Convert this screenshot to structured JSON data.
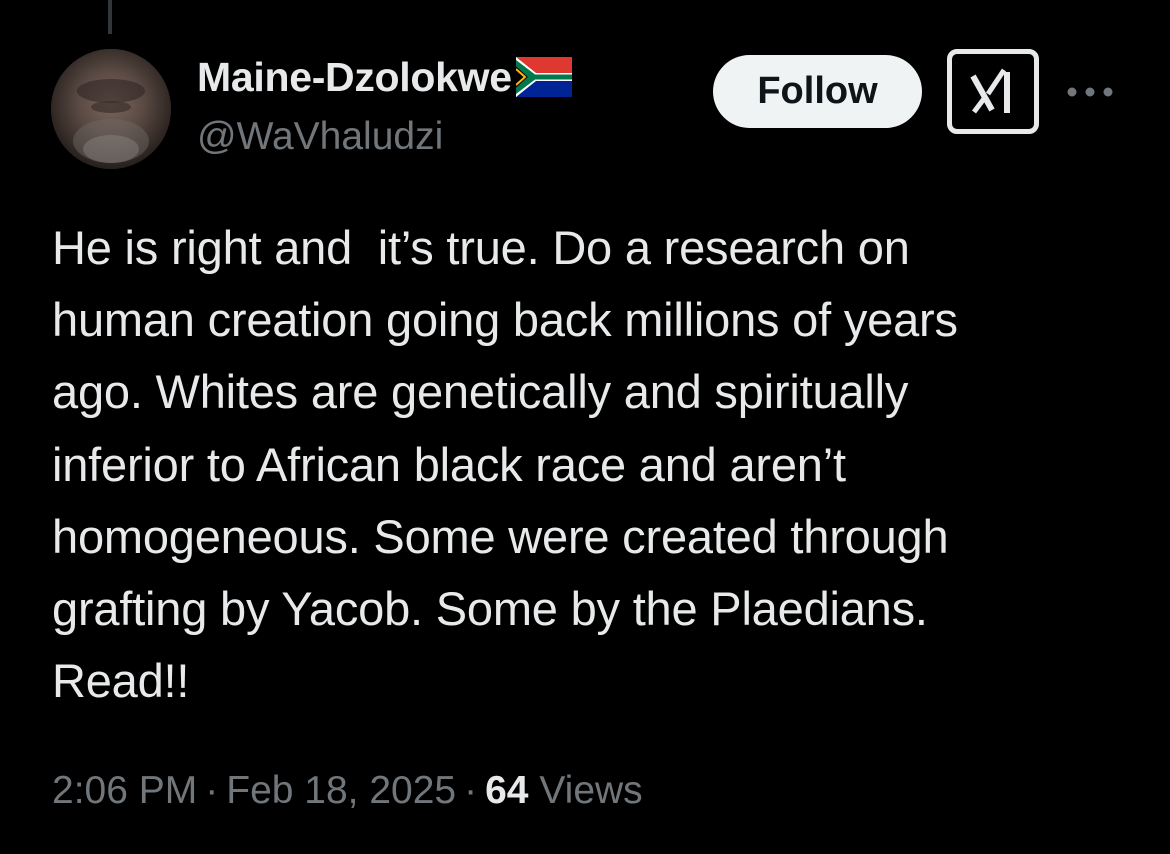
{
  "tweet": {
    "author": {
      "display_name": "Maine-Dzolokwe",
      "flag_icon": "south-africa-flag-icon",
      "handle": "@WaVhaludzi"
    },
    "follow_label": "Follow",
    "grok_icon": "grok-icon",
    "more_icon": "more-icon",
    "text": "He is right and  it’s true. Do a research on\nhuman creation going back millions of years\nago. Whites are genetically and spiritually\ninferior to African black race and aren’t\nhomogeneous. Some were created through\ngrafting by Yacob. Some by the Plaedians.\nRead!!",
    "time": "2:06 PM",
    "separator": "·",
    "date": "Feb 18, 2025",
    "views_count": "64",
    "views_label": "Views"
  },
  "colors": {
    "background": "#000000",
    "primary_text": "#e7e9ea",
    "secondary_text": "#71767b",
    "follow_bg": "#eff3f4",
    "follow_text": "#0f1419"
  }
}
